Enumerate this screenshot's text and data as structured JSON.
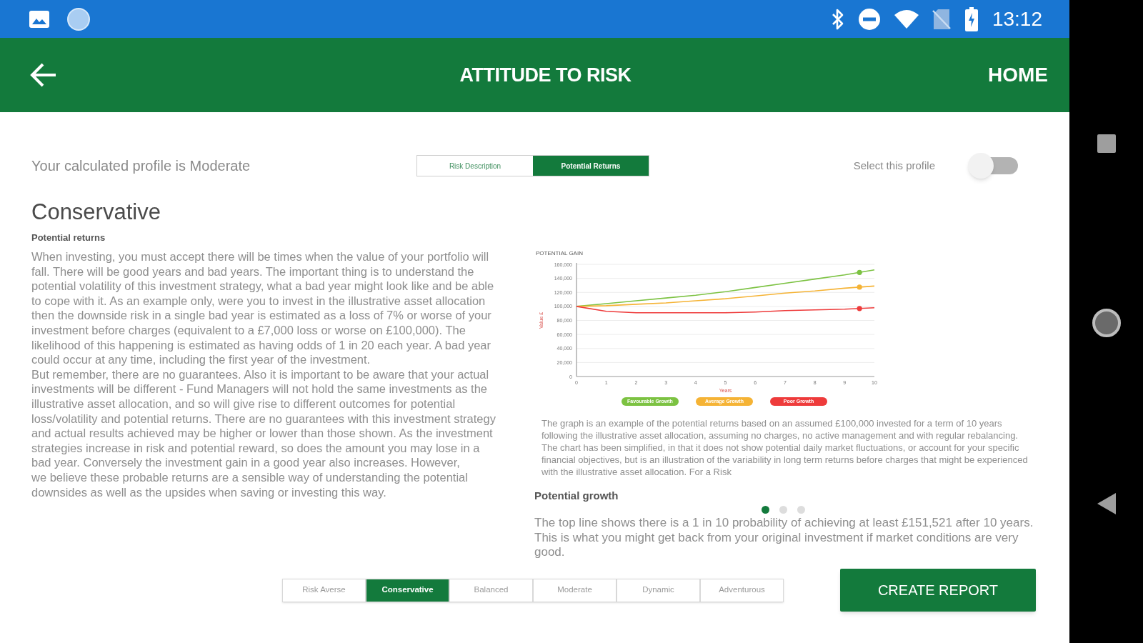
{
  "status_bar": {
    "time": "13:12"
  },
  "app_bar": {
    "title": "ATTITUDE TO RISK",
    "action": "HOME"
  },
  "profile": {
    "summary": "Your calculated profile is Moderate",
    "view_tabs": [
      {
        "label": "Risk Description",
        "selected": false
      },
      {
        "label": "Potential Returns",
        "selected": true
      }
    ],
    "select_profile": {
      "label": "Select this profile",
      "on": false
    }
  },
  "risk_profile": {
    "title": "Conservative",
    "subtitle": "Potential returns",
    "description": "When investing, you must accept there will be times when the value of your portfolio will fall. There will be good years and bad years. The important thing is to understand the potential volatility of this investment strategy, what a bad year might look like and be able to cope with it.  As an example only, were you to invest in the illustrative asset allocation then the downside risk in a single bad year is estimated as a loss of 7% or worse of your investment before charges (equivalent to a £7,000 loss or worse on £100,000). The likelihood of this happening is estimated as having odds of 1 in 20 each year. A bad year could occur at any time, including the first year of the investment.\nBut remember, there are no guarantees. Also it is important to be aware that your actual investments will be different - Fund Managers will not hold the same investments as the illustrative asset allocation, and so will give rise to different outcomes for potential loss/volatility and potential returns.  There are no guarantees with this investment strategy and actual results achieved may be higher or lower than those shown. As the investment strategies increase in risk and potential reward, so does the amount you may lose in a bad year. Conversely the investment gain in a good year also increases. However,\nwe believe these probable returns are a sensible way of understanding the potential downsides as well as the upsides when saving or investing this way."
  },
  "chart": {
    "chart_data": {
      "type": "line",
      "title": "POTENTIAL GAIN",
      "xlabel": "Years",
      "ylabel": "Value £",
      "x": [
        0,
        1,
        2,
        3,
        4,
        5,
        6,
        7,
        8,
        9,
        10
      ],
      "series": [
        {
          "name": "Favourable Growth",
          "color": "#7cc242",
          "values": [
            100000,
            104000,
            108000,
            112000,
            116000,
            121000,
            127000,
            133000,
            139000,
            145000,
            152000
          ]
        },
        {
          "name": "Average Growth",
          "color": "#f5b335",
          "values": [
            100000,
            101000,
            103000,
            105000,
            108000,
            111000,
            115000,
            119000,
            122000,
            126000,
            129000
          ]
        },
        {
          "name": "Poor Growth",
          "color": "#ee3b3b",
          "values": [
            100000,
            93000,
            91000,
            91000,
            91000,
            91000,
            92000,
            94000,
            95000,
            96000,
            98000
          ]
        }
      ],
      "xlim": [
        0,
        10
      ],
      "ylim": [
        0,
        160000
      ],
      "xticks": [
        0,
        1,
        2,
        3,
        4,
        5,
        6,
        7,
        8,
        9,
        10
      ],
      "yticks": [
        {
          "value": 0,
          "label": "0"
        },
        {
          "value": 20000,
          "label": "20,000"
        },
        {
          "value": 40000,
          "label": "40,000"
        },
        {
          "value": 60000,
          "label": "60,000"
        },
        {
          "value": 80000,
          "label": "80,000"
        },
        {
          "value": 100000,
          "label": "100,000"
        },
        {
          "value": 120000,
          "label": "120,000"
        },
        {
          "value": 140000,
          "label": "140,000"
        },
        {
          "value": 160000,
          "label": "160,000"
        }
      ],
      "grid": true
    },
    "caption": "The graph is an example of the potential returns based on an assumed £100,000 invested for a term of 10 years following the illustrative asset allocation, assuming no charges, no active management and with regular rebalancing. The chart has been simplified, in that it does not show potential daily market fluctuations, or account for your specific financial objectives, but is an illustration of the variability in long term returns before charges that might be experienced with the illustrative asset allocation. For a Risk"
  },
  "growth": {
    "title": "Potential growth",
    "page_dots": [
      {
        "selected": true
      },
      {
        "selected": false
      },
      {
        "selected": false
      }
    ],
    "text": "The top line shows there is a 1 in 10 probability of achieving at least £151,521 after 10 years.  This is what you might get back from your original investment if market conditions are very good."
  },
  "profile_tabs": [
    {
      "label": "Risk Averse",
      "selected": false
    },
    {
      "label": "Conservative",
      "selected": true
    },
    {
      "label": "Balanced",
      "selected": false
    },
    {
      "label": "Moderate",
      "selected": false
    },
    {
      "label": "Dynamic",
      "selected": false
    },
    {
      "label": "Adventurous",
      "selected": false
    }
  ],
  "create_report": "CREATE REPORT"
}
